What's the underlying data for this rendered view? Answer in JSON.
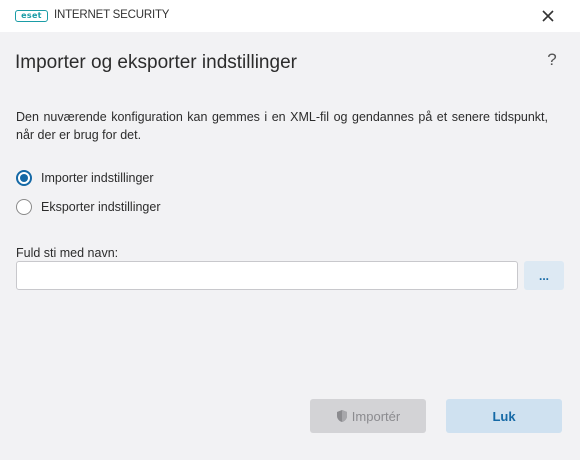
{
  "window": {
    "logo_text": "eset",
    "product_name": "INTERNET SECURITY"
  },
  "dialog": {
    "title": "Importer og eksporter indstillinger",
    "help_label": "?",
    "description": "Den nuværende konfiguration kan gemmes i en XML-fil og gendannes på et senere tidspunkt, når der er brug for det.",
    "options": [
      {
        "label": "Importer indstillinger",
        "selected": true
      },
      {
        "label": "Eksporter indstillinger",
        "selected": false
      }
    ],
    "path_label": "Fuld sti med navn:",
    "path_value": "",
    "browse_label": "...",
    "import_label": "Importér",
    "close_label": "Luk"
  },
  "colors": {
    "accent": "#1569a6",
    "logo": "#1a9ca6",
    "background": "#f2f2f4"
  }
}
